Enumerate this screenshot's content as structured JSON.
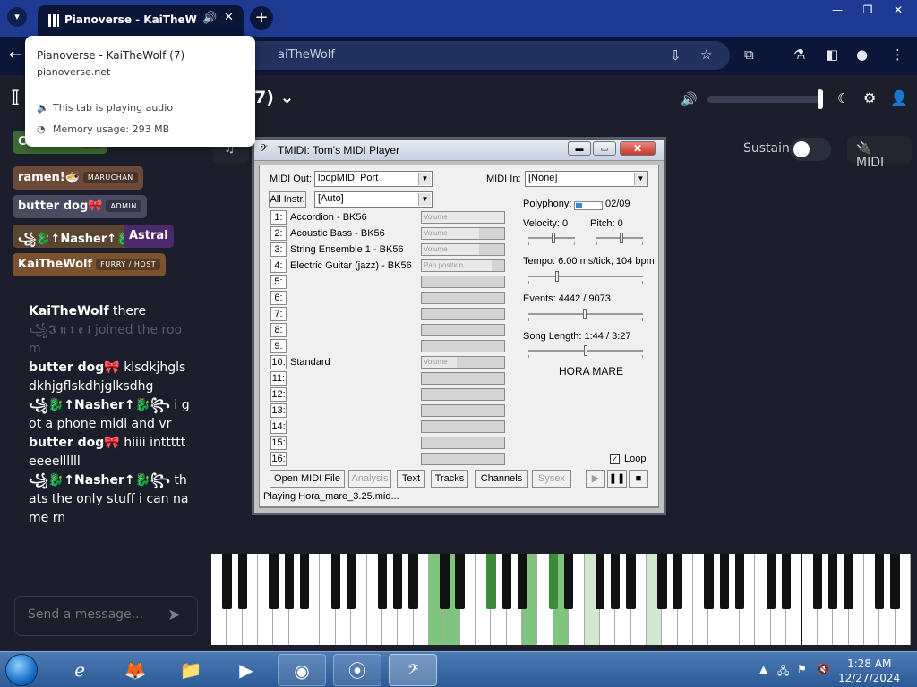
{
  "browser": {
    "tab_title": "Pianoverse - KaiTheWolf (7",
    "omnibox_text": "aiTheWolf",
    "window_controls": [
      "—",
      "❐",
      "✕"
    ]
  },
  "hover_card": {
    "title": "Pianoverse - KaiTheWolf (7)",
    "url": "pianoverse.net",
    "audio_text": "This tab is playing audio",
    "memory_text": "Memory usage: 293 MB"
  },
  "page": {
    "room_title": "7)",
    "sustain_label": "Sustain",
    "midi_label": "MIDI",
    "users": [
      {
        "name": "CollabVM",
        "role": "BE",
        "color": "#3e6b33"
      },
      {
        "name": "ramen!🍜",
        "role": "MARUCHAN",
        "color": "#6b4a3a"
      },
      {
        "name": "butter dog🎀",
        "role": "ADMIN",
        "color": "#4a4a60"
      },
      {
        "name": "꧁🐉↑Nasher↑🐉꧂",
        "role": "",
        "color": "#5a4530"
      },
      {
        "name": "Astral",
        "role": "",
        "color": "#4b2a6b"
      },
      {
        "name": "KaiTheWolf",
        "role": "FURRY / HOST",
        "color": "#7a5230"
      }
    ],
    "chat": [
      {
        "name": "KaiTheWolf",
        "text": "there",
        "faded": false
      },
      {
        "name": "",
        "text": "꧁𝕴 𝖓 𝖙 𝖊 𝖑 joined the room",
        "faded": true
      },
      {
        "name": "butter dog🎀",
        "text": "klsdkjhglsdkhjgflskdhjglksdhg",
        "faded": false
      },
      {
        "name": "꧁🐉↑Nasher↑🐉꧂",
        "text": "i got a phone midi and vr",
        "faded": false
      },
      {
        "name": "butter dog🎀",
        "text": "hiiii inttttteeeellllll",
        "faded": false
      },
      {
        "name": "꧁🐉↑Nasher↑🐉꧂",
        "text": "thats the only stuff i can name rn",
        "faded": false
      }
    ],
    "chat_placeholder": "Send a message..."
  },
  "tmidi": {
    "title": "TMIDI: Tom's MIDI Player",
    "midi_out_label": "MIDI Out:",
    "midi_out_value": "loopMIDI Port",
    "midi_in_label": "MIDI In:",
    "midi_in_value": "[None]",
    "all_instr_label": "All Instr.",
    "instr_value": "[Auto]",
    "channels": [
      {
        "num": "1:",
        "name": "Accordion - BK56",
        "bar": "Volume",
        "level": 1.0
      },
      {
        "num": "2:",
        "name": "Acoustic Bass - BK56",
        "bar": "Volume",
        "level": 0.7
      },
      {
        "num": "3:",
        "name": "String Ensemble 1 - BK56",
        "bar": "Volume",
        "level": 0.7
      },
      {
        "num": "4:",
        "name": "Electric Guitar (jazz) - BK56",
        "bar": "Pan position",
        "level": 0.85
      },
      {
        "num": "5:",
        "name": "",
        "bar": "",
        "level": 0
      },
      {
        "num": "6:",
        "name": "",
        "bar": "",
        "level": 0
      },
      {
        "num": "7:",
        "name": "",
        "bar": "",
        "level": 0
      },
      {
        "num": "8:",
        "name": "",
        "bar": "",
        "level": 0
      },
      {
        "num": "9:",
        "name": "",
        "bar": "",
        "level": 0
      },
      {
        "num": "10:",
        "name": "Standard",
        "bar": "Volume",
        "level": 0.42
      },
      {
        "num": "11:",
        "name": "",
        "bar": "",
        "level": 0
      },
      {
        "num": "12:",
        "name": "",
        "bar": "",
        "level": 0
      },
      {
        "num": "13:",
        "name": "",
        "bar": "",
        "level": 0
      },
      {
        "num": "14:",
        "name": "",
        "bar": "",
        "level": 0
      },
      {
        "num": "15:",
        "name": "",
        "bar": "",
        "level": 0
      },
      {
        "num": "16:",
        "name": "",
        "bar": "",
        "level": 0
      }
    ],
    "polyphony_label": "Polyphony:",
    "polyphony_value": "02/09",
    "polyphony_fraction": 0.22,
    "velocity_label": "Velocity: 0",
    "pitch_label": "Pitch: 0",
    "tempo_label": "Tempo: 6.00 ms/tick, 104 bpm",
    "events_label": "Events: 4442 / 9073",
    "events_fraction": 0.49,
    "song_length_label": "Song Length: 1:44 / 3:27",
    "song_fraction": 0.5,
    "song_title": "HORA MARE",
    "loop_label": "Loop",
    "loop_checked": "✓",
    "buttons": {
      "open": "Open MIDI File",
      "analysis": "Analysis",
      "text": "Text",
      "tracks": "Tracks",
      "channels": "Channels",
      "sysex": "Sysex"
    },
    "status": "Playing Hora_mare_3.25.mid..."
  },
  "taskbar": {
    "time": "1:28 AM",
    "date": "12/27/2024"
  },
  "colors": {
    "piano_lit": "#7fc47f",
    "chrome_tab": "#1f3a93"
  }
}
